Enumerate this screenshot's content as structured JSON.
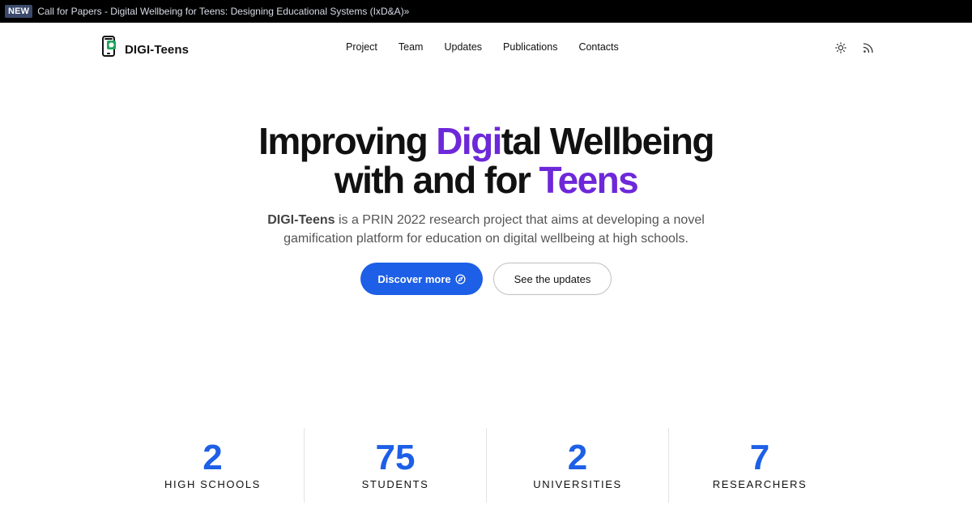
{
  "announcement": {
    "badge": "NEW",
    "text": "Call for Papers - Digital Wellbeing for Teens: Designing Educational Systems (IxD&A)»"
  },
  "brand": {
    "name": "DIGI-Teens",
    "logo_icon": "phone-logo-icon"
  },
  "nav": {
    "items": [
      "Project",
      "Team",
      "Updates",
      "Publications",
      "Contacts"
    ]
  },
  "actions": {
    "theme_icon": "sun-icon",
    "rss_icon": "rss-icon"
  },
  "hero": {
    "title_part1": "Improving ",
    "title_accent": "Digi",
    "title_part2": "tal Wellbeing",
    "title_line2_part1": "with and for ",
    "title_line2_accent": "Teens",
    "lead_strong": "DIGI-Teens",
    "lead_rest": " is a PRIN 2022 research project that aims at developing a novel gamification platform for education on digital wellbeing at high schools.",
    "primary_button": "Discover more",
    "secondary_button": "See the updates"
  },
  "stats": [
    {
      "value": "2",
      "label": "HIGH SCHOOLS"
    },
    {
      "value": "75",
      "label": "STUDENTS"
    },
    {
      "value": "2",
      "label": "UNIVERSITIES"
    },
    {
      "value": "7",
      "label": "RESEARCHERS"
    }
  ],
  "colors": {
    "accent_purple": "#6d28d9",
    "accent_blue": "#1d5fe6",
    "announcement_bg": "#000000"
  }
}
